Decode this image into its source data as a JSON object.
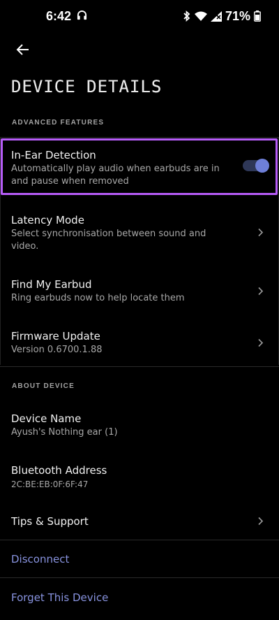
{
  "status_bar": {
    "time": "6:42",
    "battery_percent": "71%",
    "icons": [
      "headphones-icon",
      "bluetooth-icon",
      "wifi-icon",
      "signal-icon",
      "battery-icon"
    ]
  },
  "header": {
    "title": "DEVICE DETAILS"
  },
  "advanced": {
    "section_label": "ADVANCED FEATURES",
    "in_ear": {
      "title": "In-Ear Detection",
      "subtitle": "Automatically play audio when earbuds are in and pause when removed",
      "enabled": true
    },
    "latency": {
      "title": "Latency Mode",
      "subtitle": "Select synchronisation between sound and video."
    },
    "find": {
      "title": "Find My Earbud",
      "subtitle": "Ring earbuds now to help locate them"
    },
    "firmware": {
      "title": "Firmware Update",
      "subtitle": "Version 0.6700.1.88"
    }
  },
  "about": {
    "section_label": "ABOUT DEVICE",
    "device_name": {
      "title": "Device Name",
      "value": "Ayush's Nothing ear (1)"
    },
    "bt_address": {
      "title": "Bluetooth Address",
      "value": "2C:BE:EB:0F:6F:47"
    },
    "tips": {
      "title": "Tips & Support"
    }
  },
  "actions": {
    "disconnect": "Disconnect",
    "forget": "Forget This Device"
  },
  "colors": {
    "background": "#000000",
    "highlight": "#b65cf7",
    "accent": "#8893df",
    "toggle_knob": "#6e7fd8"
  }
}
